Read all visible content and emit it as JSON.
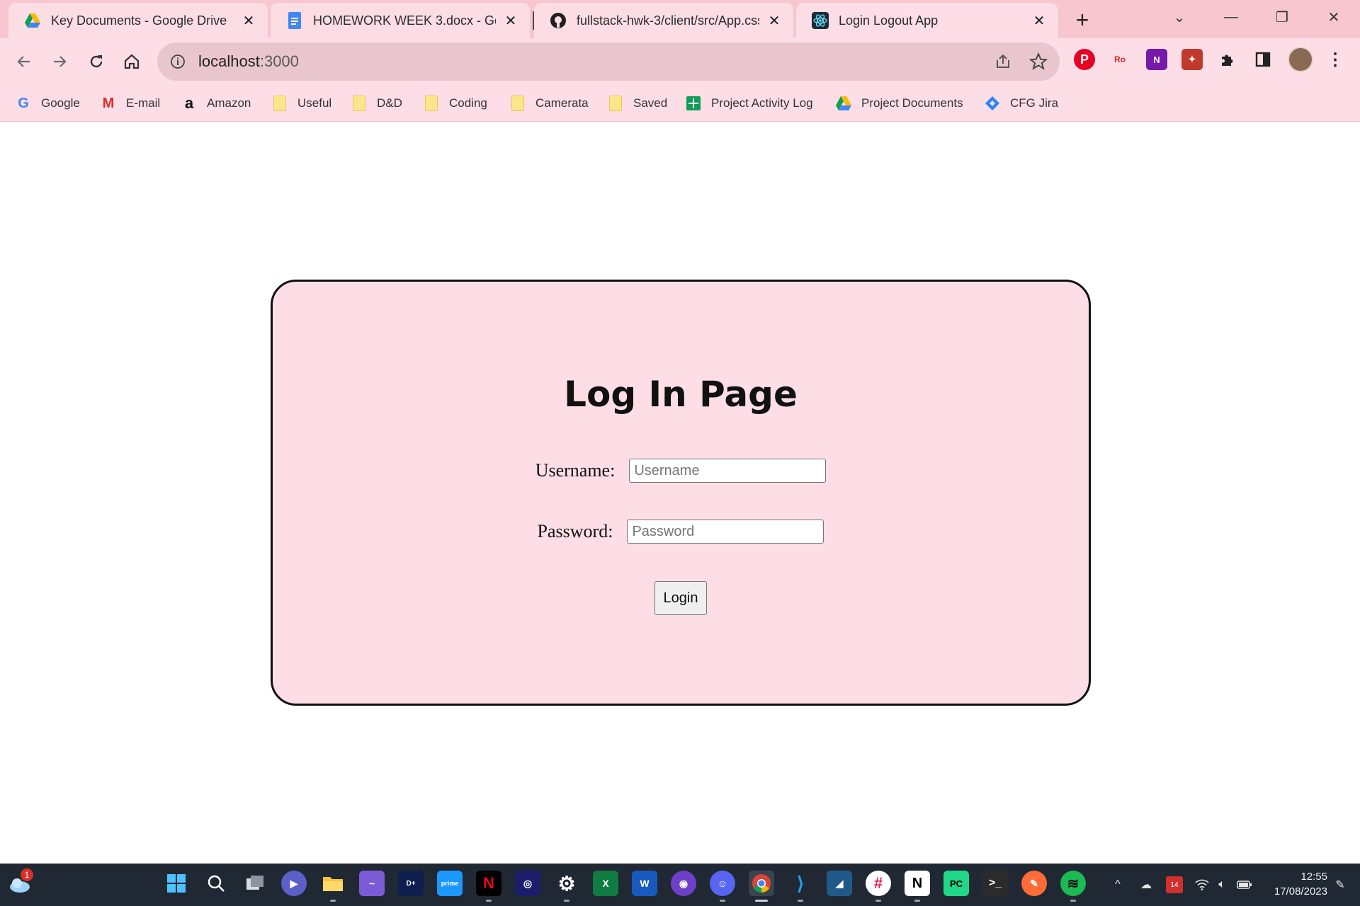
{
  "tabs": [
    {
      "title": "Key Documents - Google Drive",
      "icon": "google-drive-icon",
      "active": false
    },
    {
      "title": "HOMEWORK WEEK 3.docx - Googl",
      "icon": "google-docs-icon",
      "active": false
    },
    {
      "title": "fullstack-hwk-3/client/src/App.css",
      "icon": "github-icon",
      "active": false
    },
    {
      "title": "Login Logout App",
      "icon": "react-icon",
      "active": true
    }
  ],
  "tab_close_glyph": "✕",
  "new_tab_glyph": "+",
  "window_controls": {
    "dropdown": "⌄",
    "minimize": "—",
    "restore": "❐",
    "close": "✕"
  },
  "address_bar": {
    "host": "localhost",
    "port": ":3000"
  },
  "bookmarks": [
    {
      "label": "Google",
      "icon": "google-icon"
    },
    {
      "label": "E-mail",
      "icon": "gmail-icon"
    },
    {
      "label": "Amazon",
      "icon": "amazon-icon"
    },
    {
      "label": "Useful",
      "icon": "folder-icon"
    },
    {
      "label": "D&D",
      "icon": "folder-icon"
    },
    {
      "label": "Coding",
      "icon": "folder-icon"
    },
    {
      "label": "Camerata",
      "icon": "folder-icon"
    },
    {
      "label": "Saved",
      "icon": "folder-icon"
    },
    {
      "label": "Project Activity Log",
      "icon": "google-sheets-icon"
    },
    {
      "label": "Project Documents",
      "icon": "google-drive-icon"
    },
    {
      "label": "CFG Jira",
      "icon": "jira-icon"
    }
  ],
  "login": {
    "heading": "Log In Page",
    "username_label": "Username:",
    "username_placeholder": "Username",
    "password_label": "Password:",
    "password_placeholder": "Password",
    "button_label": "Login"
  },
  "taskbar": {
    "weather_badge": "1",
    "calendar_badge": "14",
    "time": "12:55",
    "date": "17/08/2023"
  },
  "colors": {
    "tabstrip": "#f7c6cf",
    "toolbar": "#fddde6",
    "card_background": "#fddde6",
    "taskbar": "#202833"
  }
}
